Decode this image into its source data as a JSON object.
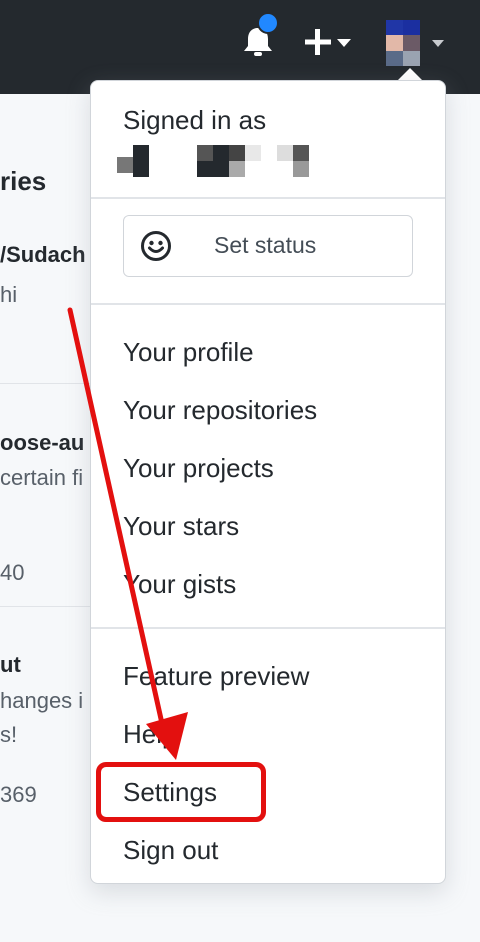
{
  "header": {
    "notifications_icon": "bell-icon",
    "create_icon": "plus-icon",
    "dropdown_icon": "caret-down-icon",
    "avatar_colors": [
      "#2036a6",
      "#1b2fa0",
      "#e2b8a8",
      "#6b5a66",
      "#5a6b88",
      "#9aa3b1"
    ]
  },
  "background": {
    "section_title": "ries",
    "items": [
      {
        "title": "/Sudach",
        "desc": "hi",
        "meta": ""
      },
      {
        "title": "oose-au",
        "desc": "certain fi",
        "meta": "40"
      },
      {
        "title": "ut",
        "desc": "hanges i",
        "desc2": "s!",
        "meta": "369"
      }
    ]
  },
  "menu": {
    "signed_in_label": "Signed in as",
    "set_status_label": "Set status",
    "set_status_icon": "smiley-icon",
    "items_primary": [
      "Your profile",
      "Your repositories",
      "Your projects",
      "Your stars",
      "Your gists"
    ],
    "items_secondary": [
      "Feature preview",
      "Help",
      "Settings",
      "Sign out"
    ]
  },
  "annotation": {
    "arrow_color": "#e3100f",
    "highlight_color": "#e3100f"
  }
}
